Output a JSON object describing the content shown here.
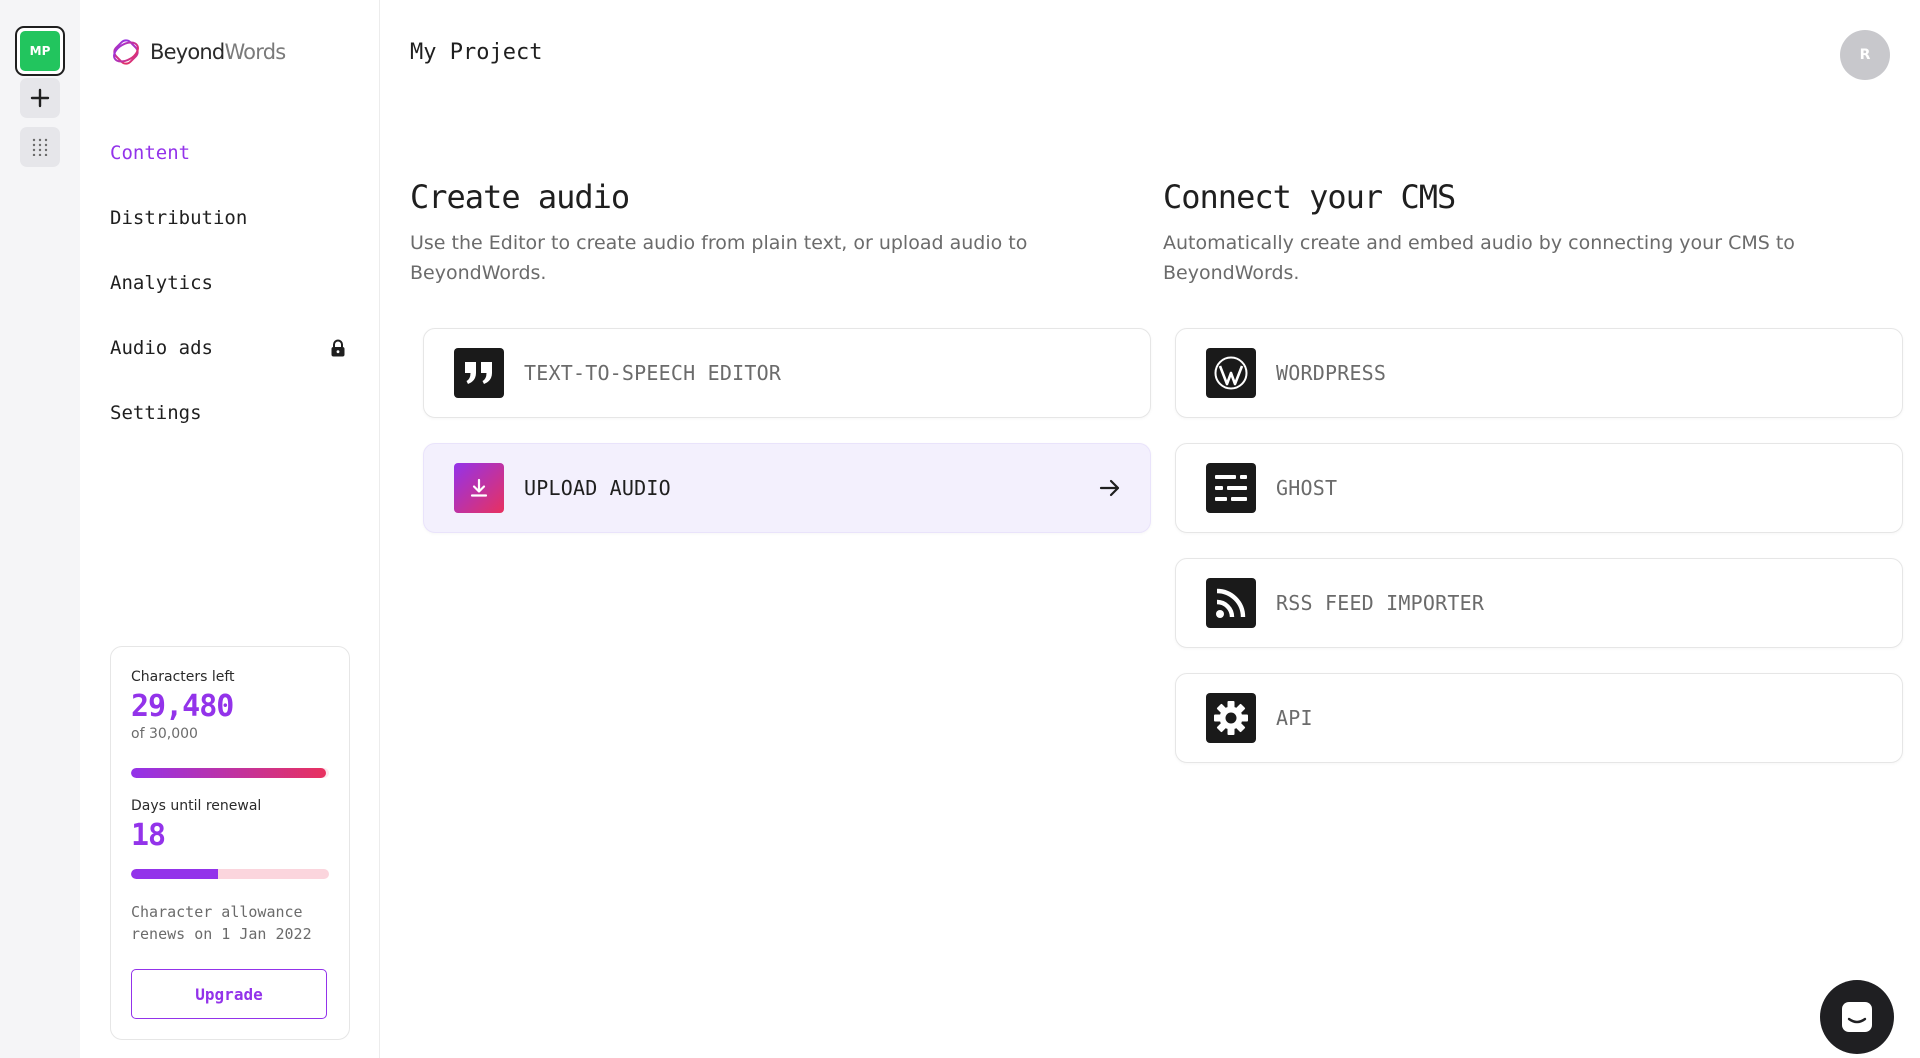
{
  "rail": {
    "project_initials": "MP"
  },
  "brand": {
    "name_bold": "Beyond",
    "name_light": "Words"
  },
  "nav": {
    "items": [
      {
        "label": "Content",
        "active": true
      },
      {
        "label": "Distribution"
      },
      {
        "label": "Analytics"
      },
      {
        "label": "Audio ads",
        "locked": true,
        "lock_icon": "lock-icon"
      },
      {
        "label": "Settings"
      }
    ]
  },
  "usage": {
    "chars_label": "Characters left",
    "chars_left": "29,480",
    "chars_total": "of 30,000",
    "chars_used_fraction": 0.983,
    "days_label": "Days until renewal",
    "days_left": "18",
    "days_fraction": 0.44,
    "renew_note": "Character allowance renews on 1 Jan 2022",
    "upgrade_label": "Upgrade"
  },
  "header": {
    "title": "My Project",
    "avatar_initial": "R"
  },
  "create": {
    "title": "Create audio",
    "description": "Use the Editor to create audio from plain text, or upload audio to BeyondWords.",
    "options": [
      {
        "label": "TEXT-TO-SPEECH EDITOR",
        "icon": "quote-icon"
      },
      {
        "label": "UPLOAD AUDIO",
        "icon": "download-icon",
        "highlighted": true
      }
    ]
  },
  "connect": {
    "title": "Connect your CMS",
    "description": "Automatically create and embed audio by connecting your CMS to BeyondWords.",
    "options": [
      {
        "label": "WORDPRESS",
        "icon": "wordpress-icon"
      },
      {
        "label": "GHOST",
        "icon": "ghost-icon"
      },
      {
        "label": "RSS FEED IMPORTER",
        "icon": "rss-icon"
      },
      {
        "label": "API",
        "icon": "gear-icon"
      }
    ]
  },
  "colors": {
    "accent": "#9333ea",
    "accent_pink": "#e8315f",
    "project_green": "#22c55e"
  }
}
